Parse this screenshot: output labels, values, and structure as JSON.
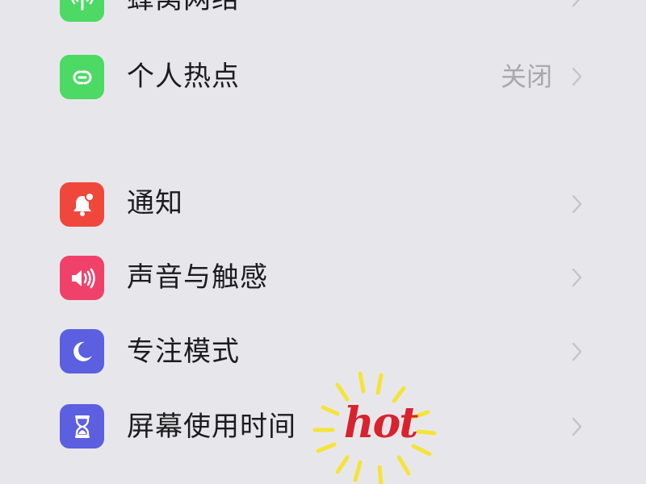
{
  "settings": {
    "items": [
      {
        "id": "cellular",
        "label": "蜂窝网络",
        "value": "",
        "icon": "antenna-icon",
        "color": "#4cd964"
      },
      {
        "id": "hotspot",
        "label": "个人热点",
        "value": "关闭",
        "icon": "hotspot-link-icon",
        "color": "#4cd964"
      },
      {
        "id": "notifications",
        "label": "通知",
        "value": "",
        "icon": "bell-icon",
        "color": "#f0473c"
      },
      {
        "id": "sounds",
        "label": "声音与触感",
        "value": "",
        "icon": "speaker-icon",
        "color": "#f0416b"
      },
      {
        "id": "focus",
        "label": "专注模式",
        "value": "",
        "icon": "moon-icon",
        "color": "#5b5fe0"
      },
      {
        "id": "screentime",
        "label": "屏幕使用时间",
        "value": "",
        "icon": "hourglass-icon",
        "color": "#5b5fe0"
      }
    ]
  },
  "sticker": {
    "text": "hot",
    "text_color": "#d8232f",
    "ray_color": "#f5e33a"
  }
}
